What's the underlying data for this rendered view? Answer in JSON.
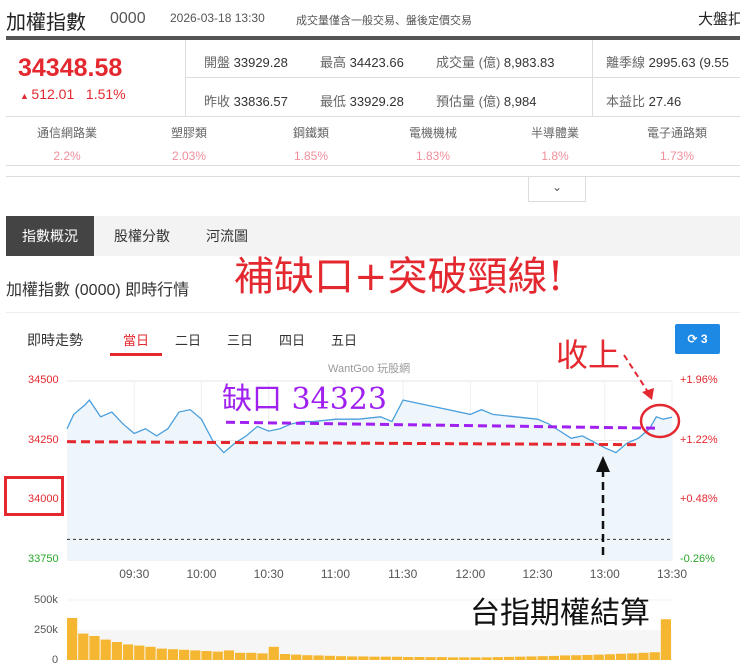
{
  "header": {
    "title": "加權指數",
    "code": "0000",
    "datetime": "2026-03-18 13:30",
    "note": "成交量僅含一般交易、盤後定價交易",
    "market": "大盤扣"
  },
  "quote": {
    "price": "34348.58",
    "change": "512.01",
    "pct": "1.51%",
    "open_l": "開盤",
    "open": "33929.28",
    "high_l": "最高",
    "high": "34423.66",
    "vol_l": "成交量 (億)",
    "vol": "8,983.83",
    "q_l": "離季線",
    "q": "2995.63 (9.55",
    "prev_l": "昨收",
    "prev": "33836.57",
    "low_l": "最低",
    "low": "33929.28",
    "est_l": "預估量 (億)",
    "est": "8,984",
    "pe_l": "本益比",
    "pe": "27.46"
  },
  "sectors": [
    {
      "name": "通信網路業",
      "pct": "2.2%"
    },
    {
      "name": "塑膠類",
      "pct": "2.03%"
    },
    {
      "name": "鋼鐵類",
      "pct": "1.85%"
    },
    {
      "name": "電機機械",
      "pct": "1.83%"
    },
    {
      "name": "半導體業",
      "pct": "1.8%"
    },
    {
      "name": "電子通路類",
      "pct": "1.73%"
    }
  ],
  "tabs": [
    "指數概況",
    "股權分散",
    "河流圖"
  ],
  "section_title": "加權指數 (0000) 即時行情",
  "chart": {
    "label": "即時走勢",
    "ranges": [
      "當日",
      "二日",
      "三日",
      "四日",
      "五日"
    ],
    "refresh": "3",
    "watermark": "WantGoo 玩股網"
  },
  "annotations": {
    "headline": "補缺口+突破頸線!",
    "gap": "缺口 34323",
    "close_above": "收上",
    "settlement": "台指期權結算"
  },
  "colors": {
    "up": "#e4282f",
    "down": "#2aa82a",
    "line": "#4a9fdc",
    "vol": "#f5b731",
    "accent": "#1e88e5"
  },
  "chart_data": {
    "type": "line",
    "ylim": [
      33750,
      34500
    ],
    "yticks": [
      "34500",
      "34250",
      "34000",
      "33750"
    ],
    "pct_ticks": [
      "+1.96%",
      "+1.22%",
      "+0.48%",
      "-0.26%"
    ],
    "xticks": [
      "09:30",
      "10:00",
      "10:30",
      "11:00",
      "11:30",
      "12:00",
      "12:30",
      "13:00",
      "13:30"
    ],
    "prev_close": 33836.57,
    "gap_level": 34323,
    "neckline": 34250,
    "price": [
      [
        0,
        34300
      ],
      [
        3,
        34360
      ],
      [
        8,
        34400
      ],
      [
        10,
        34420
      ],
      [
        15,
        34350
      ],
      [
        20,
        34370
      ],
      [
        25,
        34320
      ],
      [
        30,
        34280
      ],
      [
        35,
        34300
      ],
      [
        40,
        34270
      ],
      [
        45,
        34300
      ],
      [
        50,
        34370
      ],
      [
        55,
        34380
      ],
      [
        60,
        34340
      ],
      [
        65,
        34250
      ],
      [
        70,
        34200
      ],
      [
        75,
        34240
      ],
      [
        80,
        34270
      ],
      [
        85,
        34310
      ],
      [
        90,
        34290
      ],
      [
        95,
        34300
      ],
      [
        100,
        34320
      ],
      [
        105,
        34330
      ],
      [
        110,
        34330
      ],
      [
        120,
        34340
      ],
      [
        130,
        34340
      ],
      [
        140,
        34350
      ],
      [
        145,
        34330
      ],
      [
        150,
        34420
      ],
      [
        155,
        34410
      ],
      [
        160,
        34400
      ],
      [
        170,
        34380
      ],
      [
        180,
        34360
      ],
      [
        185,
        34380
      ],
      [
        190,
        34360
      ],
      [
        200,
        34350
      ],
      [
        210,
        34340
      ],
      [
        215,
        34320
      ],
      [
        220,
        34290
      ],
      [
        225,
        34260
      ],
      [
        230,
        34270
      ],
      [
        240,
        34220
      ],
      [
        245,
        34200
      ],
      [
        250,
        34240
      ],
      [
        255,
        34260
      ],
      [
        260,
        34300
      ],
      [
        263,
        34350
      ],
      [
        266,
        34340
      ],
      [
        270,
        34348
      ]
    ],
    "volume_ylim": [
      0,
      500
    ],
    "volume_ticks": [
      "500k",
      "250k",
      "0"
    ],
    "volume": [
      350,
      220,
      200,
      170,
      150,
      130,
      120,
      110,
      95,
      90,
      85,
      80,
      75,
      70,
      80,
      60,
      60,
      55,
      110,
      50,
      45,
      40,
      38,
      35,
      32,
      30,
      30,
      28,
      28,
      27,
      25,
      25,
      24,
      24,
      22,
      22,
      22,
      22,
      24,
      26,
      28,
      30,
      32,
      34,
      38,
      40,
      42,
      45,
      48,
      52,
      55,
      60,
      65,
      340
    ]
  }
}
